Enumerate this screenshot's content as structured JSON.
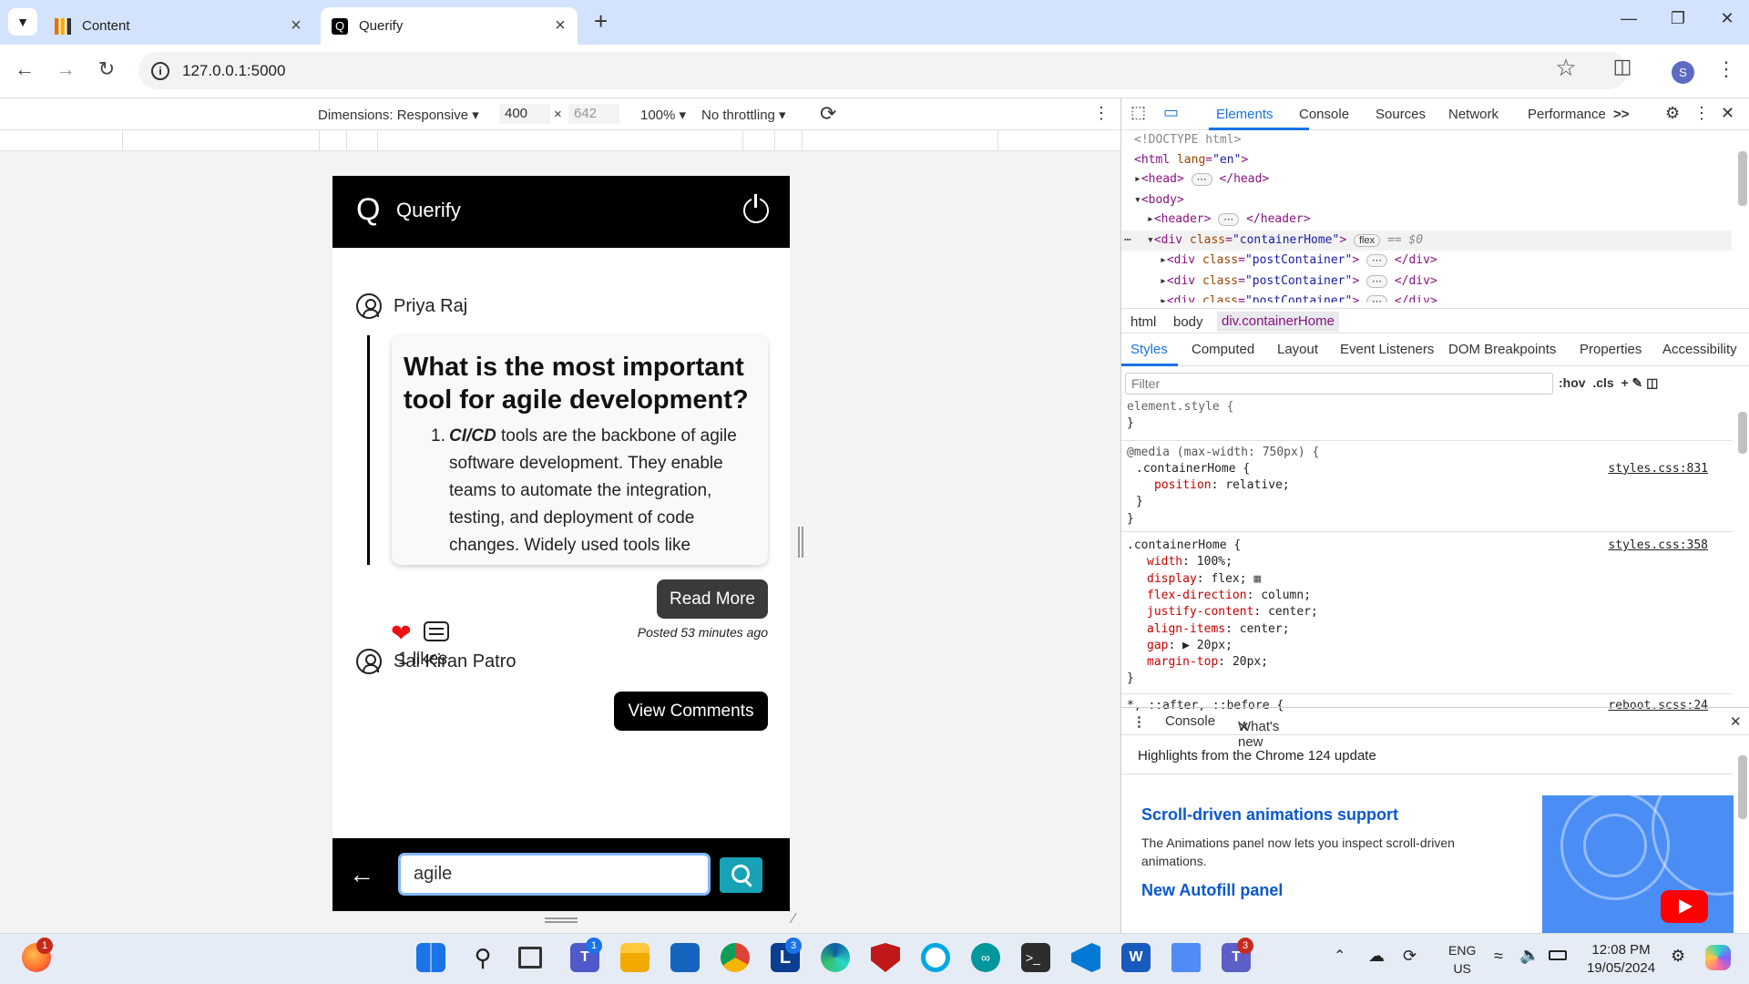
{
  "browser": {
    "tabs": [
      {
        "title": "Content",
        "active": false
      },
      {
        "title": "Querify",
        "active": true
      }
    ],
    "new_tab": "+",
    "url": "127.0.0.1:5000",
    "profile_initial": "S"
  },
  "device_toolbar": {
    "dimensions": "Dimensions: Responsive",
    "width": "400",
    "times": "×",
    "height": "642",
    "zoom": "100%",
    "throttling": "No throttling"
  },
  "app": {
    "logo": "Q",
    "name": "Querify",
    "post1": {
      "author": "Priya Raj",
      "title": "What is the most important tool for agile development?",
      "answer_number": "1.",
      "answer_bold": "CI/CD",
      "answer_text": " tools are the backbone of agile software development. They enable teams to automate the integration, testing, and deployment of code changes. Widely used tools like",
      "read_more": "Read More",
      "likes": "1 likes",
      "posted": "Posted 53 minutes ago",
      "view_comments": "View Comments"
    },
    "post2": {
      "author": "Sai Kiran Patro"
    },
    "search_value": "agile"
  },
  "devtools": {
    "tabs": [
      "Elements",
      "Console",
      "Sources",
      "Network",
      "Performance"
    ],
    "more": ">>",
    "dom": {
      "doctype": "<!DOCTYPE html>",
      "html_open": "<html",
      "lang_attr": "lang",
      "lang_val": "\"en\"",
      "head": "<head>",
      "head_close": "</head>",
      "body": "<body>",
      "header": "<header>",
      "header_close": "</header>",
      "div_open": "<div",
      "class_attr": "class",
      "container_home": "\"containerHome\"",
      "flex_badge": "flex",
      "dollar0": "== $0",
      "post_container": "\"postContainer\"",
      "div_close": "</div>"
    },
    "breadcrumb": [
      "html",
      "body",
      "div.containerHome"
    ],
    "style_tabs": [
      "Styles",
      "Computed",
      "Layout",
      "Event Listeners",
      "DOM Breakpoints",
      "Properties",
      "Accessibility"
    ],
    "filter_placeholder": "Filter",
    "filter_tools": ":hov  .cls  +",
    "css": {
      "element_style": "element.style {",
      "close": "}",
      "media": "@media (max-width: 750px) {",
      "sel1": ".containerHome {",
      "src1": "styles.css:831",
      "position_prop": "position",
      "position_val": "relative;",
      "sel2": ".containerHome {",
      "src2": "styles.css:358",
      "props": [
        {
          "name": "width",
          "value": "100%;"
        },
        {
          "name": "display",
          "value": "flex;"
        },
        {
          "name": "flex-direction",
          "value": "column;"
        },
        {
          "name": "justify-content",
          "value": "center;"
        },
        {
          "name": "align-items",
          "value": "center;"
        },
        {
          "name": "gap",
          "value": "▶ 20px;"
        },
        {
          "name": "margin-top",
          "value": "20px;"
        }
      ],
      "sel3": "*, ::after, ::before {",
      "src3": "reboot.scss:24"
    },
    "drawer": {
      "tabs": [
        "Console",
        "What's new"
      ],
      "highlights": "Highlights from the Chrome 124 update",
      "item1_title": "Scroll-driven animations support",
      "item1_desc": "The Animations panel now lets you inspect scroll-driven animations.",
      "item2_title": "New Autofill panel"
    }
  },
  "taskbar": {
    "lang": "ENG",
    "region": "US",
    "time": "12:08 PM",
    "date": "19/05/2024",
    "badge_firefox": "1",
    "badge_teams": "1",
    "badge_l": "3",
    "badge_teams2": "3",
    "l_letter": "L"
  }
}
